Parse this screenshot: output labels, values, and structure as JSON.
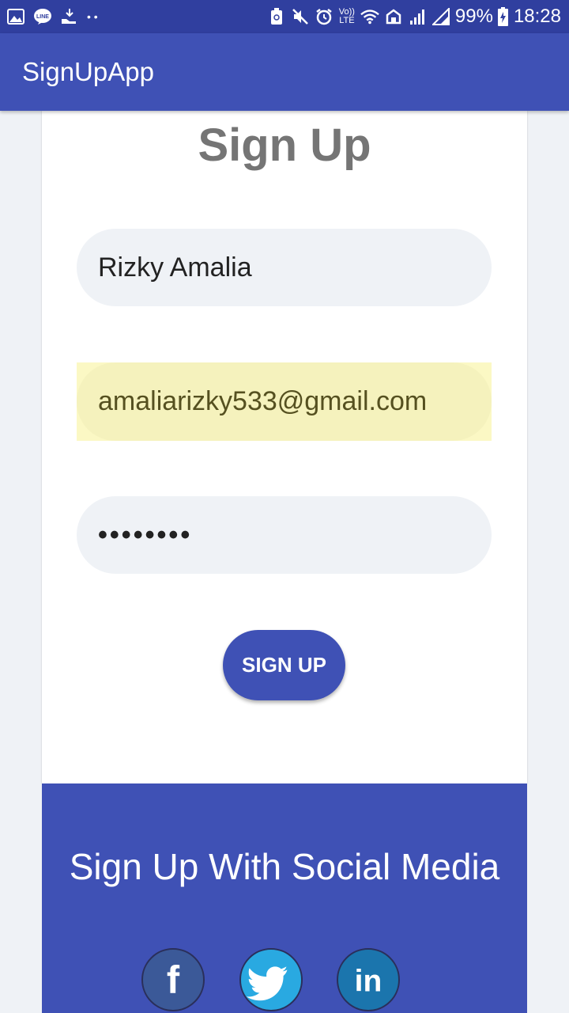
{
  "statusbar": {
    "battery": "99%",
    "time": "18:28",
    "volte": "Vo)) LTE",
    "dots": "• •"
  },
  "appbar": {
    "title": "SignUpApp"
  },
  "form": {
    "heading": "Sign Up",
    "name_value": "Rizky Amalia",
    "email_value": "amaliarizky533@gmail.com",
    "password_value": "••••••••",
    "submit_label": "SIGN UP"
  },
  "social": {
    "title": "Sign Up With Social Media",
    "buttons": [
      {
        "icon": "facebook-icon",
        "glyph": "f",
        "color": "#3b5998"
      },
      {
        "icon": "twitter-icon",
        "color": "#29a9e1"
      },
      {
        "icon": "linkedin-icon",
        "glyph": "in",
        "color": "#1b75ad"
      }
    ]
  },
  "colors": {
    "primary": "#3f51b5",
    "primary_dark": "#303f9f",
    "autofill": "#f5f2bd"
  }
}
